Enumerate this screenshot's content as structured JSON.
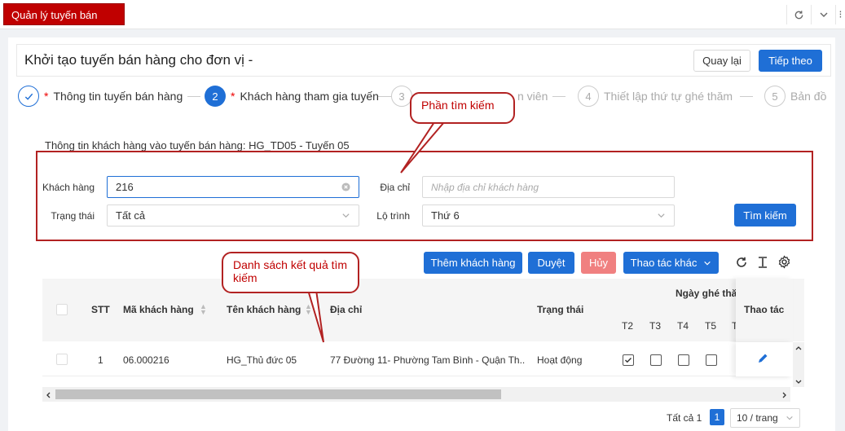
{
  "app_tab": "Quản lý tuyến bán hàng",
  "page_title": "Khởi tạo tuyến bán hàng cho đơn vị -",
  "buttons": {
    "back": "Quay lại",
    "next": "Tiếp theo",
    "search": "Tìm kiếm",
    "add_customer": "Thêm khách hàng",
    "approve": "Duyệt",
    "cancel": "Hủy",
    "other_actions": "Thao tác khác"
  },
  "steps": [
    {
      "num": "✓",
      "required": "*",
      "label": "Thông tin tuyến bán hàng"
    },
    {
      "num": "2",
      "required": "*",
      "label": "Khách hàng tham gia tuyến"
    },
    {
      "num": "3",
      "label": "n viên"
    },
    {
      "num": "4",
      "label": "Thiết lập thứ tự ghé thăm"
    },
    {
      "num": "5",
      "label": "Bản đồ"
    }
  ],
  "section_legend": "Thông tin khách hàng vào tuyến bán hàng: HG_TD05 - Tuyến 05",
  "search": {
    "customer_label": "Khách hàng",
    "customer_value": "216",
    "address_label": "Địa chỉ",
    "address_placeholder": "Nhập địa chỉ khách hàng",
    "status_label": "Trạng thái",
    "status_value": "Tất cả",
    "route_label": "Lộ trình",
    "route_value": "Thứ 6"
  },
  "callouts": {
    "search": "Phần tìm kiếm",
    "results": "Danh sách kết quả tìm kiếm"
  },
  "table": {
    "headers": {
      "stt": "STT",
      "code": "Mã khách hàng",
      "name": "Tên khách hàng",
      "address": "Địa chỉ",
      "status": "Trạng thái",
      "visit_days": "Ngày ghé thă",
      "actions": "Thao tác"
    },
    "days": [
      "T2",
      "T3",
      "T4",
      "T5",
      "T"
    ],
    "rows": [
      {
        "stt": "1",
        "code": "06.000216",
        "name": "HG_Thủ đức 05",
        "address": "77 Đường 11- Phường Tam Bình - Quận Th...",
        "status": "Hoạt động",
        "days_checked": [
          true,
          false,
          false,
          false
        ]
      }
    ]
  },
  "pagination": {
    "total": "Tất cả 1",
    "page": "1",
    "page_size": "10 / trang"
  }
}
